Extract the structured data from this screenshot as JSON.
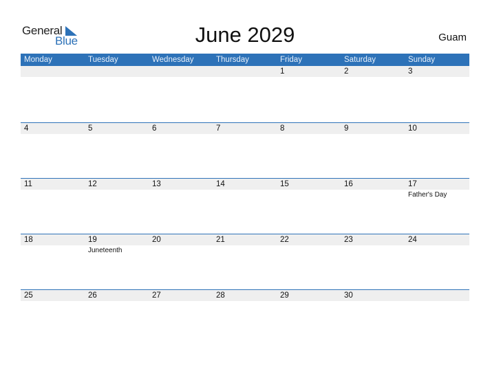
{
  "logo": {
    "word1": "General",
    "word2": "Blue"
  },
  "title": "June 2029",
  "region": "Guam",
  "colors": {
    "accent": "#2d72b8",
    "strip": "#efefef"
  },
  "days": [
    "Monday",
    "Tuesday",
    "Wednesday",
    "Thursday",
    "Friday",
    "Saturday",
    "Sunday"
  ],
  "weeks": [
    {
      "cells": [
        {
          "n": "",
          "e": ""
        },
        {
          "n": "",
          "e": ""
        },
        {
          "n": "",
          "e": ""
        },
        {
          "n": "",
          "e": ""
        },
        {
          "n": "1",
          "e": ""
        },
        {
          "n": "2",
          "e": ""
        },
        {
          "n": "3",
          "e": ""
        }
      ]
    },
    {
      "cells": [
        {
          "n": "4",
          "e": ""
        },
        {
          "n": "5",
          "e": ""
        },
        {
          "n": "6",
          "e": ""
        },
        {
          "n": "7",
          "e": ""
        },
        {
          "n": "8",
          "e": ""
        },
        {
          "n": "9",
          "e": ""
        },
        {
          "n": "10",
          "e": ""
        }
      ]
    },
    {
      "cells": [
        {
          "n": "11",
          "e": ""
        },
        {
          "n": "12",
          "e": ""
        },
        {
          "n": "13",
          "e": ""
        },
        {
          "n": "14",
          "e": ""
        },
        {
          "n": "15",
          "e": ""
        },
        {
          "n": "16",
          "e": ""
        },
        {
          "n": "17",
          "e": "Father's Day"
        }
      ]
    },
    {
      "cells": [
        {
          "n": "18",
          "e": ""
        },
        {
          "n": "19",
          "e": "Juneteenth"
        },
        {
          "n": "20",
          "e": ""
        },
        {
          "n": "21",
          "e": ""
        },
        {
          "n": "22",
          "e": ""
        },
        {
          "n": "23",
          "e": ""
        },
        {
          "n": "24",
          "e": ""
        }
      ]
    },
    {
      "cells": [
        {
          "n": "25",
          "e": ""
        },
        {
          "n": "26",
          "e": ""
        },
        {
          "n": "27",
          "e": ""
        },
        {
          "n": "28",
          "e": ""
        },
        {
          "n": "29",
          "e": ""
        },
        {
          "n": "30",
          "e": ""
        },
        {
          "n": "",
          "e": ""
        }
      ]
    }
  ]
}
